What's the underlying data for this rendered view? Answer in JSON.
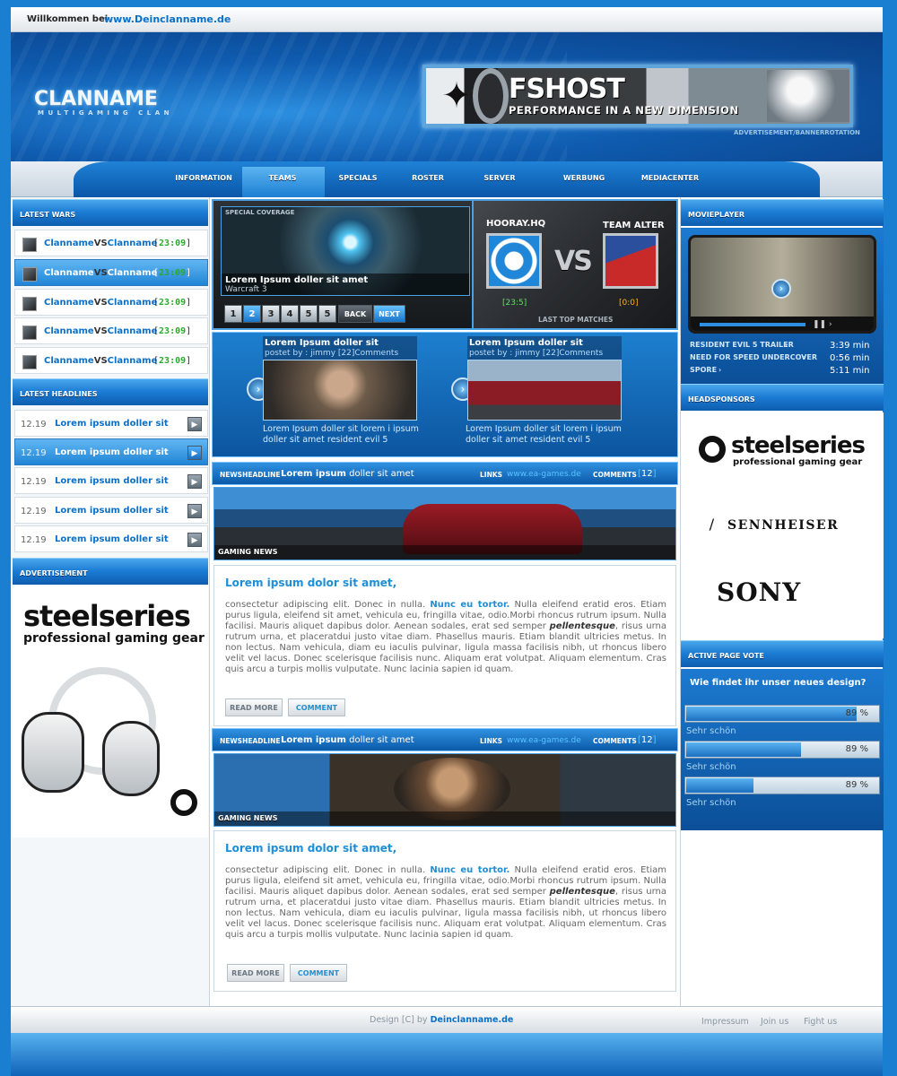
{
  "topbar": {
    "welcome": "Willkommen bei",
    "site": "www.Deinclanname.de"
  },
  "logo": {
    "name": "CLANNAME",
    "tagline": "MULTIGAMING CLAN"
  },
  "banner": {
    "title": "FSHOST",
    "subtitle": "PERFORMANCE IN A NEW DIMENSION",
    "label": "ADVERTISEMENT/BANNERROTATION"
  },
  "nav": {
    "items": [
      "INFORMATION",
      "TEAMS",
      "SPECIALS",
      "ROSTER",
      "SERVER",
      "WERBUNG",
      "MEDIACENTER"
    ],
    "active": "TEAMS"
  },
  "latest_wars": {
    "heading": "LATEST WARS",
    "items": [
      {
        "team1": "Clanname",
        "vs": "VS",
        "team2": "Clanname",
        "time": "23:09"
      },
      {
        "team1": "Clanname",
        "vs": "VS",
        "team2": "Clanname",
        "time": "23:09"
      },
      {
        "team1": "Clanname",
        "vs": "VS",
        "team2": "Clanname",
        "time": "23:09"
      },
      {
        "team1": "Clanname",
        "vs": "VS",
        "team2": "Clanname",
        "time": "23:09"
      },
      {
        "team1": "Clanname",
        "vs": "VS",
        "team2": "Clanname",
        "time": "23:09"
      }
    ]
  },
  "latest_headlines": {
    "heading": "LATEST HEADLINES",
    "items": [
      {
        "date": "12.19",
        "title": "Lorem ipsum doller sit"
      },
      {
        "date": "12.19",
        "title": "Lorem ipsum doller sit"
      },
      {
        "date": "12.19",
        "title": "Lorem ipsum doller sit"
      },
      {
        "date": "12.19",
        "title": "Lorem ipsum doller sit"
      },
      {
        "date": "12.19",
        "title": "Lorem ipsum doller sit"
      }
    ]
  },
  "advertisement": {
    "heading": "ADVERTISEMENT",
    "brand": "steelseries",
    "tagline": "professional gaming gear"
  },
  "feature": {
    "label": "SPECIAL COVERAGE",
    "title": "Lorem Ipsum doller sit amet",
    "subtitle": "Warcraft 3",
    "pages": [
      "1",
      "2",
      "3",
      "4",
      "5",
      "5"
    ],
    "active_page": 2,
    "back": "BACK",
    "next": "NEXT"
  },
  "last_match": {
    "team1": "HOORAY.HQ",
    "team2": "TEAM ALTER",
    "vs": "VS",
    "score1": "23:5",
    "score2": "0:0",
    "label": "LAST TOP MATCHES"
  },
  "mid_news": [
    {
      "title": "Lorem Ipsum doller sit",
      "by": "postet by : jimmy  [22]Comments",
      "text": "Lorem Ipsum doller sit lorem i ipsum doller sit amet resident evil 5"
    },
    {
      "title": "Lorem Ipsum doller sit",
      "by": "postet by : jimmy  [22]Comments",
      "text": "Lorem Ipsum doller sit lorem i ipsum doller sit amet resident evil 5"
    }
  ],
  "news": [
    {
      "label": "NEWSHEADLINE",
      "title_bold": "Lorem ipsum",
      "title_rest": "doller sit amet",
      "links_label": "LINKS",
      "url": "www.ea-games.de",
      "comments_label": "COMMENTS",
      "comments_count": "12",
      "image_label": "GAMING NEWS",
      "heading": "Lorem ipsum dolor sit amet,",
      "body_1": "consectetur adipiscing elit. Donec in nulla. ",
      "body_bold": "Nunc eu tortor.",
      "body_2": " Nulla eleifend eratid eros. Etiam purus ligula, eleifend sit amet, vehicula eu, fringilla vitae, odio.Morbi rhoncus rutrum ipsum. Nulla facilisi. Mauris aliquet dapibus dolor. Aenean sodales, erat sed semper ",
      "body_em": "pellentesque",
      "body_3": ", risus urna rutrum urna, et placeratdui justo vitae diam. Phasellus mauris. Etiam blandit ultricies metus. In non lectus. Nam vehicula, diam eu iaculis pulvinar, ligula massa facilisis nibh, ut rhoncus libero velit vel lacus. Donec scelerisque facilisis nunc. Aliquam erat volutpat. Aliquam elementum. Cras quis arcu a turpis mollis vulputate. Nunc lacinia sapien id quam.",
      "read_more": "READ MORE",
      "comment": "COMMENT"
    },
    {
      "label": "NEWSHEADLINE",
      "title_bold": "Lorem ipsum",
      "title_rest": "doller sit amet",
      "links_label": "LINKS",
      "url": "www.ea-games.de",
      "comments_label": "COMMENTS",
      "comments_count": "12",
      "image_label": "GAMING NEWS",
      "heading": "Lorem ipsum dolor sit amet,",
      "body_1": "consectetur adipiscing elit. Donec in nulla. ",
      "body_bold": "Nunc eu tortor.",
      "body_2": " Nulla eleifend eratid eros. Etiam purus ligula, eleifend sit amet, vehicula eu, fringilla vitae, odio.Morbi rhoncus rutrum ipsum. Nulla facilisi. Mauris aliquet dapibus dolor. Aenean sodales, erat sed semper ",
      "body_em": "pellentesque",
      "body_3": ", risus urna rutrum urna, et placeratdui justo vitae diam. Phasellus mauris. Etiam blandit ultricies metus. In non lectus. Nam vehicula, diam eu iaculis pulvinar, ligula massa facilisis nibh, ut rhoncus libero velit vel lacus. Donec scelerisque facilisis nunc. Aliquam erat volutpat. Aliquam elementum. Cras quis arcu a turpis mollis vulputate. Nunc lacinia sapien id quam.",
      "read_more": "READ MORE",
      "comment": "COMMENT"
    }
  ],
  "movieplayer": {
    "heading": "MOVIEPLAYER",
    "items": [
      {
        "title": "RESIDENT EVIL 5 TRAILER",
        "length": "3:39 min"
      },
      {
        "title": "NEED FOR SPEED UNDERCOVER",
        "length": "0:56 min"
      },
      {
        "title": "SPORE",
        "length": "5:11 min"
      }
    ]
  },
  "headsponsors": {
    "heading": "HEADSPONSORS",
    "items": [
      "steelseries",
      "SENNHEISER",
      "SONY"
    ],
    "steelseries_tagline": "professional gaming gear"
  },
  "vote": {
    "heading": "ACTIVE PAGE VOTE",
    "question": "Wie findet ihr unser neues design?",
    "options": [
      {
        "label": "Sehr schön",
        "percent_text": "89 %",
        "fill": 0.89
      },
      {
        "label": "Sehr schön",
        "percent_text": "89 %",
        "fill": 0.6
      },
      {
        "label": "Sehr schön",
        "percent_text": "89 %",
        "fill": 0.35
      }
    ]
  },
  "footer": {
    "design": "Design [C] by",
    "site": "Deinclanname.de",
    "links": [
      "Impressum",
      "Join us",
      "Fight us"
    ]
  }
}
